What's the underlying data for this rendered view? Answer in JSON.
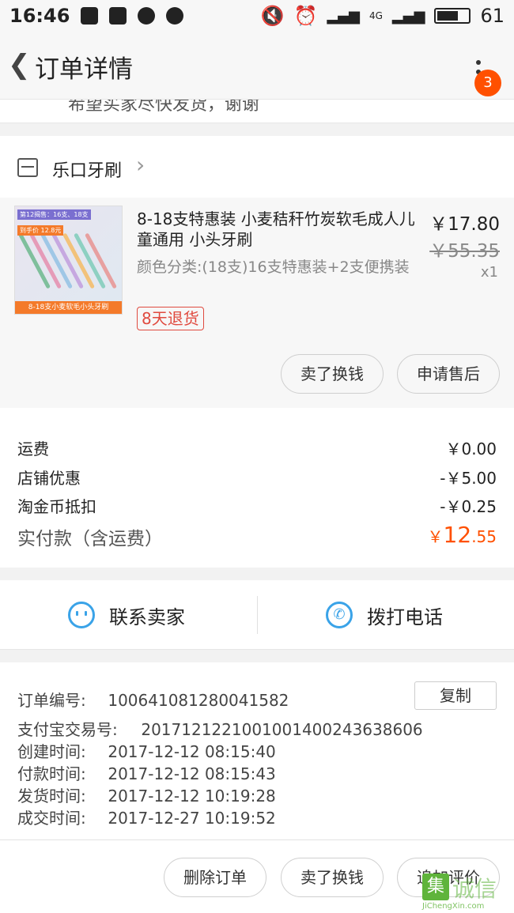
{
  "status_bar": {
    "time": "16:46",
    "network": "4G",
    "battery": "61"
  },
  "header": {
    "title": "订单详情",
    "badge_count": "3"
  },
  "partial_note": "希望买家尽快发货，谢谢",
  "shop": {
    "name": "乐口牙刷"
  },
  "product": {
    "name": "8-18支特惠装 小麦秸秆竹炭软毛成人儿童通用 小头牙刷",
    "sku": "颜色分类:(18支)16支特惠装+2支便携装",
    "price": "￥17.80",
    "original_price": "￥55.35",
    "quantity": "x1",
    "tag": "8天退货",
    "image": {
      "top_tag": "第12揭售：16支、18支",
      "price_tag": "到手价 12.8元",
      "caption": "8-18支小麦软毛小头牙刷"
    },
    "buttons": {
      "resell": "卖了换钱",
      "after_sale": "申请售后"
    }
  },
  "fees": {
    "rows": [
      {
        "label": "运费",
        "value": "￥0.00"
      },
      {
        "label": "店铺优惠",
        "value": "-￥5.00"
      },
      {
        "label": "淘金币抵扣",
        "value": "-￥0.25"
      }
    ],
    "total_label": "实付款（含运费）",
    "total_currency": "￥",
    "total_int": "12",
    "total_dec": ".55"
  },
  "contact": {
    "seller": "联系卖家",
    "call": "拨打电话"
  },
  "order_info": {
    "copy_label": "复制",
    "rows": [
      {
        "label": "订单编号:",
        "value": "100641081280041582"
      },
      {
        "label": "支付宝交易号:",
        "value": "2017121221001001400243638606"
      },
      {
        "label": "创建时间:",
        "value": "2017-12-12 08:15:40"
      },
      {
        "label": "付款时间:",
        "value": "2017-12-12 08:15:43"
      },
      {
        "label": "发货时间:",
        "value": "2017-12-12 10:19:28"
      },
      {
        "label": "成交时间:",
        "value": "2017-12-27 10:19:52"
      }
    ]
  },
  "bottom_bar": {
    "delete": "删除订单",
    "resell": "卖了换钱",
    "review": "追加评价"
  },
  "watermark": {
    "mark": "集",
    "cn": "诚信",
    "en": "JiChengXin.com"
  }
}
